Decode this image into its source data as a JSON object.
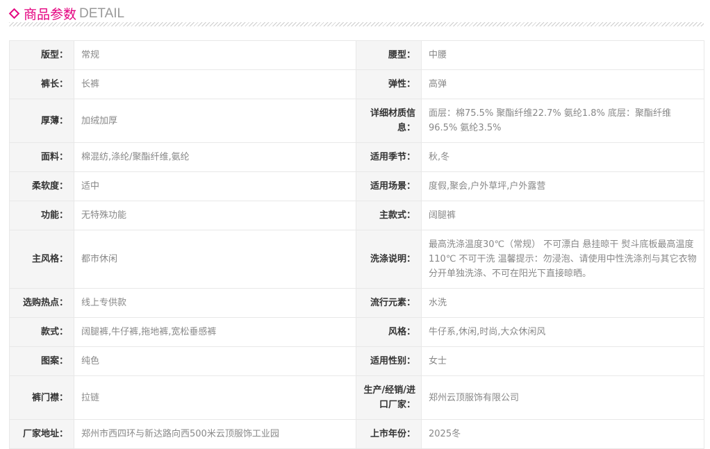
{
  "header": {
    "title_cn": "商品参数",
    "title_en": "DETAIL",
    "accent": "#e4007f"
  },
  "rows": [
    [
      {
        "k": "版型：",
        "v": "常规"
      },
      {
        "k": "腰型：",
        "v": "中腰"
      }
    ],
    [
      {
        "k": "裤长：",
        "v": "长裤"
      },
      {
        "k": "弹性：",
        "v": "高弹"
      }
    ],
    [
      {
        "k": "厚薄：",
        "v": "加绒加厚"
      },
      {
        "k": "详细材质信息：",
        "v": "面层：棉75.5% 聚酯纤维22.7% 氨纶1.8% 底层：聚酯纤维96.5% 氨纶3.5%"
      }
    ],
    [
      {
        "k": "面料：",
        "v": "棉混纺,涤纶/聚酯纤维,氨纶"
      },
      {
        "k": "适用季节：",
        "v": "秋,冬"
      }
    ],
    [
      {
        "k": "柔软度：",
        "v": "适中"
      },
      {
        "k": "适用场景：",
        "v": "度假,聚会,户外草坪,户外露营"
      }
    ],
    [
      {
        "k": "功能：",
        "v": "无特殊功能"
      },
      {
        "k": "主款式：",
        "v": "阔腿裤"
      }
    ],
    [
      {
        "k": "主风格：",
        "v": "都市休闲"
      },
      {
        "k": "洗涤说明：",
        "v": "最高洗涤温度30℃（常规） 不可漂白 悬挂晾干 熨斗底板最高温度110℃ 不可干洗 温馨提示：勿浸泡、请使用中性洗涤剂与其它衣物分开单独洗涤、不可在阳光下直接晾晒。"
      }
    ],
    [
      {
        "k": "选购热点：",
        "v": "线上专供款"
      },
      {
        "k": "流行元素：",
        "v": "水洗"
      }
    ],
    [
      {
        "k": "款式：",
        "v": "阔腿裤,牛仔裤,拖地裤,宽松垂感裤"
      },
      {
        "k": "风格：",
        "v": "牛仔系,休闲,时尚,大众休闲风"
      }
    ],
    [
      {
        "k": "图案：",
        "v": "纯色"
      },
      {
        "k": "适用性别：",
        "v": "女士"
      }
    ],
    [
      {
        "k": "裤门襟：",
        "v": "拉链"
      },
      {
        "k": "生产/经销/进口厂家：",
        "v": "郑州云顶服饰有限公司"
      }
    ],
    [
      {
        "k": "厂家地址：",
        "v": "郑州市西四环与新达路向西500米云顶服饰工业园"
      },
      {
        "k": "上市年份：",
        "v": "2025冬"
      }
    ]
  ]
}
